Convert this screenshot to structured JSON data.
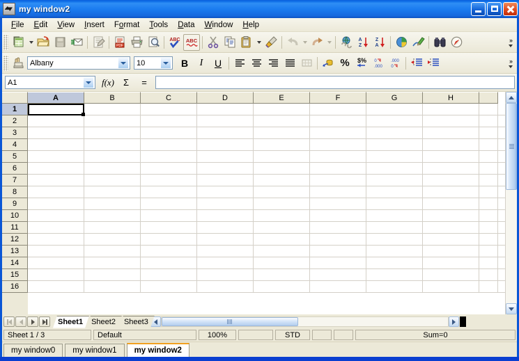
{
  "window": {
    "title": "my window2",
    "icon": "calc-document-icon",
    "buttons": [
      {
        "name": "minimize-button",
        "label": "_"
      },
      {
        "name": "maximize-button",
        "label": "□"
      },
      {
        "name": "close-button",
        "label": "×"
      }
    ]
  },
  "menubar": {
    "items": [
      {
        "label": "File",
        "accel": "F"
      },
      {
        "label": "Edit",
        "accel": "E"
      },
      {
        "label": "View",
        "accel": "V"
      },
      {
        "label": "Insert",
        "accel": "I"
      },
      {
        "label": "Format",
        "accel": "o"
      },
      {
        "label": "Tools",
        "accel": "T"
      },
      {
        "label": "Data",
        "accel": "D"
      },
      {
        "label": "Window",
        "accel": "W"
      },
      {
        "label": "Help",
        "accel": "H"
      }
    ]
  },
  "standard_toolbar": {
    "overflow_label": "»",
    "items": [
      {
        "name": "new-document-button",
        "icon": "new-spreadsheet-icon"
      },
      {
        "name": "new-document-dropdown",
        "icon": "chevron-down-icon"
      },
      {
        "name": "open-button",
        "icon": "open-folder-icon"
      },
      {
        "name": "save-button",
        "icon": "save-disk-icon"
      },
      {
        "name": "send-email-button",
        "icon": "envelope-icon"
      },
      {
        "name": "edit-file-button",
        "icon": "edit-document-icon"
      },
      {
        "name": "export-pdf-button",
        "icon": "pdf-icon"
      },
      {
        "name": "print-button",
        "icon": "printer-icon"
      },
      {
        "name": "print-preview-button",
        "icon": "magnifier-page-icon"
      },
      {
        "name": "spelling-button",
        "icon": "abc-check-icon"
      },
      {
        "name": "autospellcheck-button",
        "icon": "abc-wave-icon"
      },
      {
        "name": "cut-button",
        "icon": "scissors-icon"
      },
      {
        "name": "copy-button",
        "icon": "copy-pages-icon"
      },
      {
        "name": "paste-button",
        "icon": "clipboard-icon"
      },
      {
        "name": "paste-dropdown",
        "icon": "chevron-down-icon"
      },
      {
        "name": "clone-formatting-button",
        "icon": "paintbrush-icon"
      },
      {
        "name": "undo-button",
        "icon": "undo-arrow-icon"
      },
      {
        "name": "undo-dropdown",
        "icon": "chevron-down-icon"
      },
      {
        "name": "redo-button",
        "icon": "redo-arrow-icon"
      },
      {
        "name": "redo-dropdown",
        "icon": "chevron-down-icon"
      },
      {
        "name": "hyperlink-button",
        "icon": "globe-chain-icon"
      },
      {
        "name": "sort-ascending-button",
        "icon": "sort-az-icon"
      },
      {
        "name": "sort-descending-button",
        "icon": "sort-za-icon"
      },
      {
        "name": "chart-button",
        "icon": "pie-chart-icon"
      },
      {
        "name": "draw-functions-button",
        "icon": "pencil-line-icon"
      },
      {
        "name": "find-replace-button",
        "icon": "binoculars-icon"
      },
      {
        "name": "navigator-button",
        "icon": "compass-icon"
      }
    ]
  },
  "format_toolbar": {
    "overflow_label": "»",
    "font_name": {
      "value": "Albany",
      "name": "font-name-combo"
    },
    "font_size": {
      "value": "10",
      "name": "font-size-combo"
    },
    "bold_label": "B",
    "italic_label": "I",
    "underline_label": "U",
    "items": [
      {
        "name": "styles-button",
        "icon": "stamp-hand-icon"
      },
      {
        "name": "align-left-button",
        "icon": "align-left-icon"
      },
      {
        "name": "align-center-button",
        "icon": "align-center-icon"
      },
      {
        "name": "align-right-button",
        "icon": "align-right-icon"
      },
      {
        "name": "align-justified-button",
        "icon": "align-justify-icon"
      },
      {
        "name": "merge-cells-button",
        "icon": "merge-cells-icon"
      },
      {
        "name": "currency-format-button",
        "icon": "coins-icon"
      },
      {
        "name": "percent-format-button",
        "icon": "percent-icon"
      },
      {
        "name": "standard-format-button",
        "icon": "dollar-percent-icon"
      },
      {
        "name": "add-decimal-button",
        "icon": "add-decimal-icon"
      },
      {
        "name": "delete-decimal-button",
        "icon": "delete-decimal-icon"
      },
      {
        "name": "decrease-indent-button",
        "icon": "decrease-indent-icon"
      },
      {
        "name": "increase-indent-button",
        "icon": "increase-indent-icon"
      }
    ]
  },
  "formula_bar": {
    "name_box": {
      "value": "A1",
      "name": "cell-reference-box"
    },
    "function_wizard_label": "f(x)",
    "sum_label": "Σ",
    "equals_label": "=",
    "input_line": {
      "value": "",
      "name": "formula-input-line"
    }
  },
  "sheet": {
    "columns": [
      "A",
      "B",
      "C",
      "D",
      "E",
      "F",
      "G",
      "H"
    ],
    "partial_column": "",
    "rows": [
      "1",
      "2",
      "3",
      "4",
      "5",
      "6",
      "7",
      "8",
      "9",
      "10",
      "11",
      "12",
      "13",
      "14",
      "15",
      "16"
    ],
    "selected_column": "A",
    "selected_row": "1",
    "active_cell": "A1",
    "cell_values": []
  },
  "sheet_tabs": {
    "nav": [
      {
        "name": "first-sheet-button",
        "icon": "first-icon"
      },
      {
        "name": "previous-sheet-button",
        "icon": "previous-icon"
      },
      {
        "name": "next-sheet-button",
        "icon": "next-icon"
      },
      {
        "name": "last-sheet-button",
        "icon": "last-icon"
      }
    ],
    "tabs": [
      {
        "label": "Sheet1",
        "active": true
      },
      {
        "label": "Sheet2",
        "active": false
      },
      {
        "label": "Sheet3",
        "active": false
      }
    ]
  },
  "statusbar": {
    "sheet_position": "Sheet 1 / 3",
    "page_style": "Default",
    "zoom": "100%",
    "insert_mode": "",
    "selection_mode": "STD",
    "modified": "",
    "signature": "",
    "summary": "Sum=0"
  },
  "taskbar": {
    "windows": [
      {
        "label": "my window0",
        "active": false
      },
      {
        "label": "my window1",
        "active": false
      },
      {
        "label": "my window2",
        "active": true
      }
    ]
  },
  "colors": {
    "title_bar_blue": "#1b7cf0",
    "window_border": "#0a3fd0",
    "toolbar_beige": "#ece9d8",
    "header_selected": "#bfc8db",
    "active_tab_accent": "#f0a020",
    "grid_line": "#d4d0c8"
  }
}
